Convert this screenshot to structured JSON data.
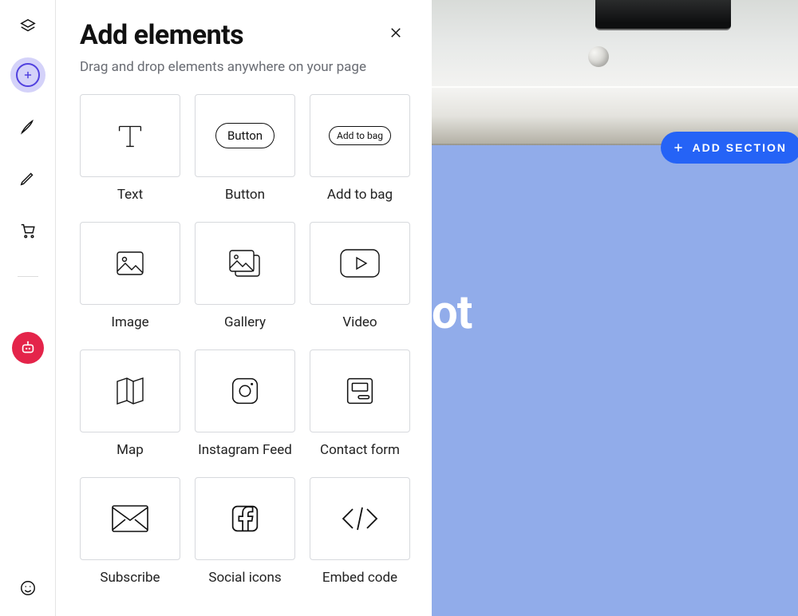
{
  "panel": {
    "title": "Add elements",
    "subtitle": "Drag and drop elements anywhere on your page",
    "elements": [
      {
        "label": "Text"
      },
      {
        "label": "Button",
        "pill": "Button"
      },
      {
        "label": "Add to bag",
        "pill": "Add to bag"
      },
      {
        "label": "Image"
      },
      {
        "label": "Gallery"
      },
      {
        "label": "Video"
      },
      {
        "label": "Map"
      },
      {
        "label": "Instagram Feed"
      },
      {
        "label": "Contact form"
      },
      {
        "label": "Subscribe"
      },
      {
        "label": "Social icons"
      },
      {
        "label": "Embed code"
      }
    ]
  },
  "canvas": {
    "title_fragment": "ot",
    "add_section_label": "ADD SECTION"
  }
}
